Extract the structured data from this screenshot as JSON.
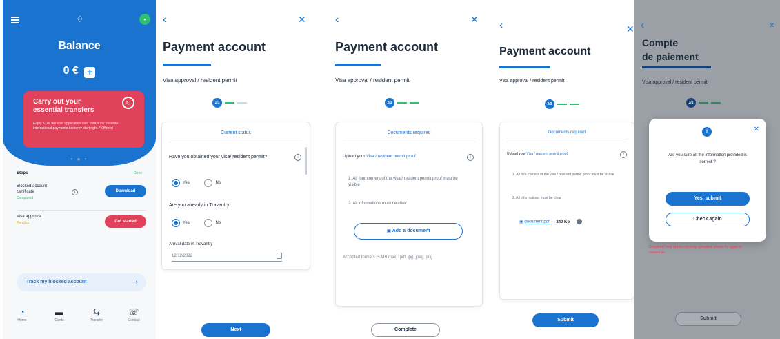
{
  "screen1": {
    "balance_title": "Balance",
    "balance_amount": "0 €",
    "plus_label": "+",
    "promo": {
      "title": "Carry out your essential transfers",
      "body": "Enjoy a 0 € fee cost application card obtain my possible international payments to do my start right. * Offered"
    },
    "steps_heading": "Steps",
    "steps_link": "Done",
    "steps": [
      {
        "title": "Blocked account certificate",
        "status": "Completed",
        "action": "Download",
        "status_color": "#2fbf71"
      },
      {
        "title": "Visa approval",
        "status": "Pending",
        "action": "Get started",
        "status_color": "#d8a300"
      }
    ],
    "track_label": "Track my blocked account",
    "tabs": [
      {
        "label": "Home",
        "icon": "home-icon"
      },
      {
        "label": "Cards",
        "icon": "card-icon"
      },
      {
        "label": "Transfer",
        "icon": "transfer-icon"
      },
      {
        "label": "Contact",
        "icon": "phone-icon"
      }
    ]
  },
  "screen2": {
    "title": "Payment account",
    "subtitle": "Visa approval / resident permit",
    "step": "1/3",
    "card_title": "Current status",
    "q1": "Have you obtained your visa/ resident permit?",
    "q2": "Are you already in Travantry",
    "yes": "Yes",
    "no": "No",
    "date_label": "Arrival date in Travantry",
    "date_value": "12/12/2022",
    "button": "Next"
  },
  "screen3": {
    "title": "Payment account",
    "subtitle": "Visa approval / resident permit",
    "step": "2/3",
    "card_title": "Documents required",
    "upload_prefix": "Upload your ",
    "upload_link": "Visa / resident permit proof",
    "bullet1": "1. All four corners of the visa / resident permit proof must be visible",
    "bullet2": "2. All informations must be clear",
    "add_doc": "Add a document",
    "formats": "Accepted formats (5 MB max): pdf, jpg, jpeg, png",
    "button": "Complete"
  },
  "screen4": {
    "title": "Payment account",
    "subtitle": "Visa approval / resident permit",
    "step": "2/3",
    "card_title": "Documents required",
    "upload_prefix": "Upload your ",
    "upload_link": "Visa / resident permit proof",
    "bullet1": "1. All four corners of the visa / resident permit proof must be visible",
    "bullet2": "2. All informations must be clear",
    "file_name": "document.pdf",
    "file_size": "240 Ko",
    "button": "Submit"
  },
  "screen5": {
    "title_line1": "Compte",
    "title_line2": "de paiement",
    "subtitle": "Visa approval / resident permit",
    "step": "3/3",
    "dialog_text": "Are you sure all the information provided is correct ?",
    "confirm": "Yes, submit",
    "check": "Check again",
    "error": "Document may not be correctly uploaded, please try again or contact us",
    "button": "Submit"
  },
  "colors": {
    "primary": "#1b73d0",
    "accent_red": "#e0415b",
    "success": "#2fbf71",
    "pending": "#d8a300"
  }
}
